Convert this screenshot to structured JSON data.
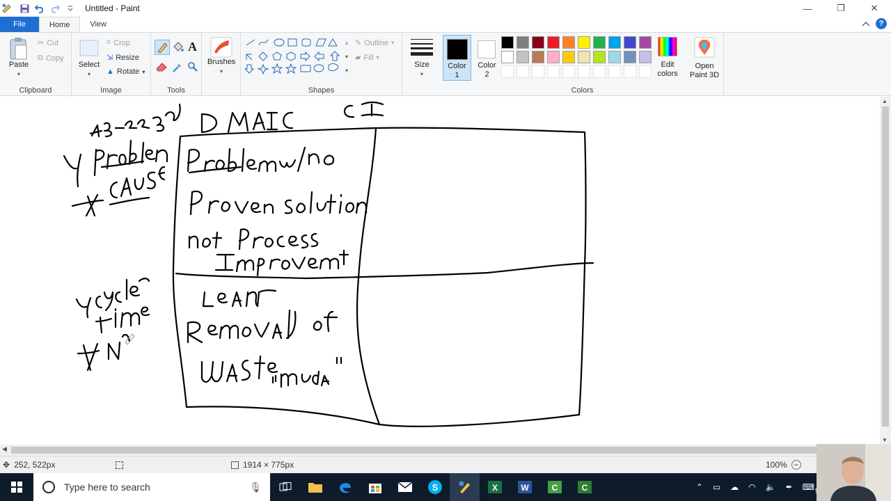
{
  "window": {
    "title": "Untitled - Paint",
    "controls": {
      "minimize": "—",
      "restore": "❐",
      "close": "✕"
    }
  },
  "tabs": {
    "file": "File",
    "home": "Home",
    "view": "View"
  },
  "ribbon": {
    "clipboard": {
      "paste": "Paste",
      "cut": "Cut",
      "copy": "Copy",
      "label": "Clipboard"
    },
    "image": {
      "select": "Select",
      "crop": "Crop",
      "resize": "Resize",
      "rotate": "Rotate",
      "label": "Image"
    },
    "tools": {
      "label": "Tools",
      "text_tool": "A"
    },
    "brushes": {
      "label": "Brushes"
    },
    "shapes": {
      "outline": "Outline",
      "fill": "Fill",
      "label": "Shapes"
    },
    "size": {
      "label": "Size"
    },
    "colors": {
      "color1_label": "Color",
      "color1_num": "1",
      "color2_label": "Color",
      "color2_num": "2",
      "label": "Colors",
      "edit": "Edit colors",
      "color1": "#000000",
      "color2": "#ffffff",
      "palette_row1": [
        "#000000",
        "#7f7f7f",
        "#880015",
        "#ed1c24",
        "#ff7f27",
        "#fff200",
        "#22b14c",
        "#00a2e8",
        "#3f48cc",
        "#a349a4"
      ],
      "palette_row2": [
        "#ffffff",
        "#c3c3c3",
        "#b97a57",
        "#ffaec9",
        "#ffc90e",
        "#efe4b0",
        "#b5e61d",
        "#99d9ea",
        "#7092be",
        "#c8bfe7"
      ]
    },
    "paint3d": {
      "label": "Open Paint 3D"
    }
  },
  "status": {
    "cursor_pos": "252, 522px",
    "canvas_size": "1914 × 775px",
    "zoom": "100%"
  },
  "taskbar": {
    "search_placeholder": "Type here to search",
    "clock_time": "1",
    "clock_date": "9/"
  }
}
